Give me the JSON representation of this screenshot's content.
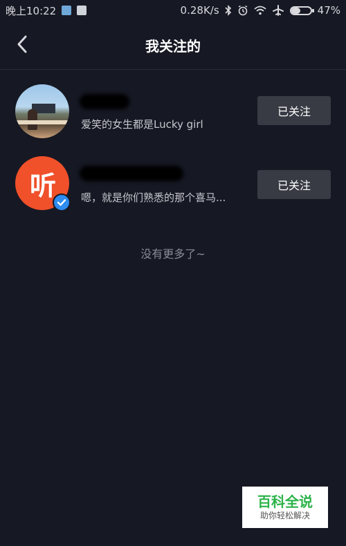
{
  "status_bar": {
    "time": "晚上10:22",
    "speed": "0.28K/s",
    "battery_text": "47%",
    "battery_level": 0.47,
    "icons": [
      "home-notification-icon",
      "message-notification-icon",
      "bluetooth-icon",
      "alarm-icon",
      "wifi-icon",
      "airplane-icon",
      "battery-icon"
    ]
  },
  "header": {
    "title": "我关注的",
    "back_icon": "chevron-left-icon"
  },
  "follow_list": [
    {
      "name": "",
      "description": "爱笑的女生都是Lucky girl",
      "button_label": "已关注",
      "verified": false
    },
    {
      "name": "",
      "description": "嗯，就是你们熟悉的那个喜马...",
      "button_label": "已关注",
      "verified": true,
      "avatar_text": "听"
    }
  ],
  "list_end_text": "没有更多了~",
  "watermark": {
    "title": "百科全说",
    "subtitle": "助你轻松解决"
  },
  "colors": {
    "background": "#161823",
    "button_bg": "#393b44",
    "brand_orange": "#f0502a",
    "verified_blue": "#2f8cf0"
  }
}
